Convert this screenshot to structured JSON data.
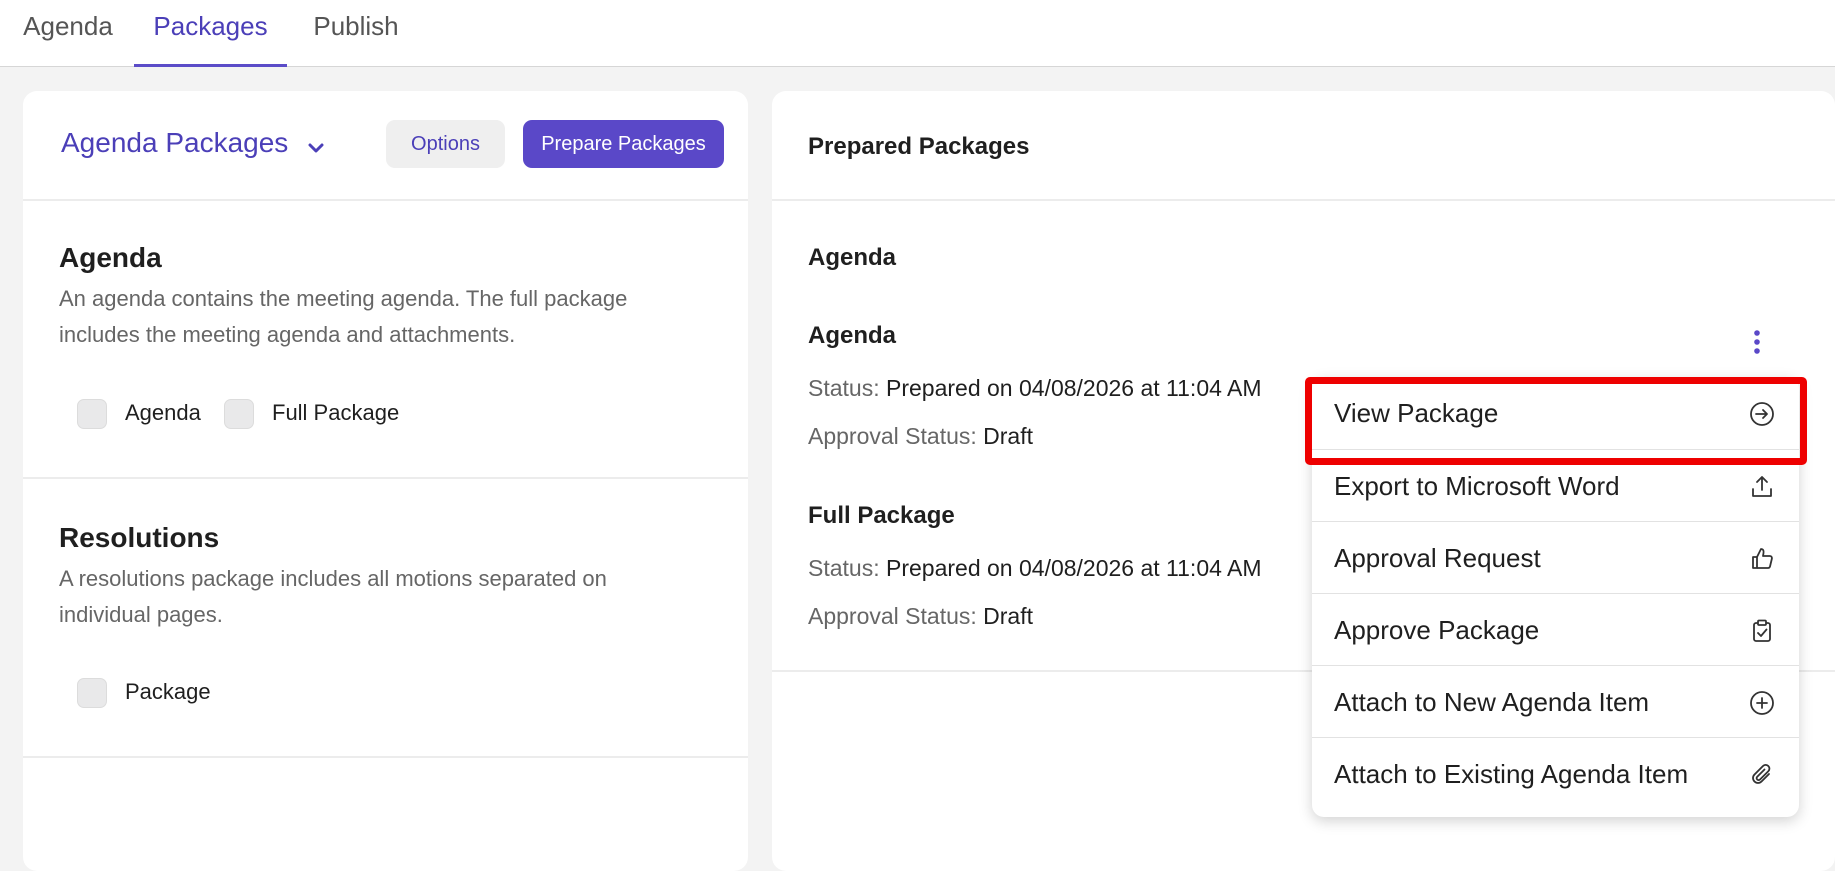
{
  "tabs": [
    {
      "label": "Agenda",
      "active": false
    },
    {
      "label": "Packages",
      "active": true
    },
    {
      "label": "Publish",
      "active": false
    }
  ],
  "left_panel": {
    "header": {
      "dropdown_label": "Agenda Packages",
      "options_label": "Options",
      "prepare_label": "Prepare Packages"
    },
    "sections": [
      {
        "title": "Agenda",
        "description": "An agenda contains the meeting agenda. The full package includes the meeting agenda and attachments.",
        "checkboxes": [
          "Agenda",
          "Full Package"
        ]
      },
      {
        "title": "Resolutions",
        "description": "A resolutions package includes all motions separated on individual pages.",
        "checkboxes": [
          "Package"
        ]
      }
    ]
  },
  "right_panel": {
    "title": "Prepared Packages",
    "group_label": "Agenda",
    "packages": [
      {
        "name": "Agenda",
        "status_label": "Status:",
        "status_value": "Prepared on 04/08/2026 at 11:04 AM",
        "approval_label": "Approval Status:",
        "approval_value": "Draft"
      },
      {
        "name": "Full Package",
        "status_label": "Status:",
        "status_value": "Prepared on 04/08/2026 at 11:04 AM",
        "approval_label": "Approval Status:",
        "approval_value": "Draft"
      }
    ]
  },
  "menu": {
    "items": [
      {
        "label": "View Package",
        "icon": "arrow-circle-right-icon"
      },
      {
        "label": "Export to Microsoft Word",
        "icon": "export-icon"
      },
      {
        "label": "Approval Request",
        "icon": "thumbs-up-icon"
      },
      {
        "label": "Approve Package",
        "icon": "clipboard-check-icon"
      },
      {
        "label": "Attach to New Agenda Item",
        "icon": "plus-circle-icon"
      },
      {
        "label": "Attach to Existing Agenda Item",
        "icon": "paperclip-icon"
      }
    ]
  },
  "colors": {
    "accent": "#5a48c8",
    "accent_text": "#4b3fb8",
    "highlight": "#ee0000"
  }
}
